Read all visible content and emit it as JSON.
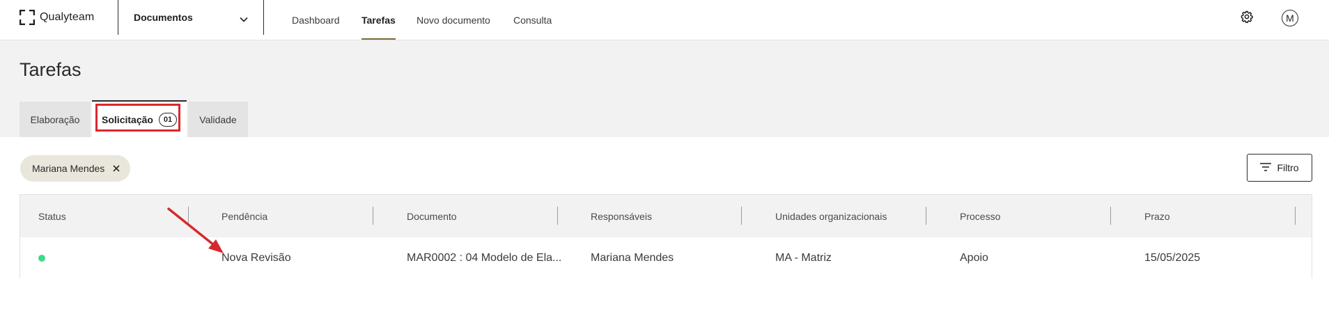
{
  "topbar": {
    "logo_text": "Qualyteam",
    "module_label": "Documentos",
    "nav": [
      {
        "label": "Dashboard",
        "active": false
      },
      {
        "label": "Tarefas",
        "active": true
      },
      {
        "label": "Novo documento",
        "active": false
      },
      {
        "label": "Consulta",
        "active": false
      }
    ],
    "settings_icon": "gear-icon",
    "avatar_initial": "M"
  },
  "page": {
    "title": "Tarefas",
    "tabs": [
      {
        "label": "Elaboração",
        "active": false
      },
      {
        "label": "Solicitação",
        "active": true,
        "badge": "01"
      },
      {
        "label": "Validade",
        "active": false
      }
    ]
  },
  "filters": {
    "chip_label": "Mariana Mendes",
    "filter_button_label": "Filtro"
  },
  "table": {
    "columns": [
      "Status",
      "Pendência",
      "Documento",
      "Responsáveis",
      "Unidades organizacionais",
      "Processo",
      "Prazo"
    ],
    "rows": [
      {
        "status_color": "#3ddc84",
        "pendencia": "Nova Revisão",
        "documento": "MAR0002 : 04 Modelo de Ela...",
        "responsaveis": "Mariana Mendes",
        "unidades": "MA - Matriz",
        "processo": "Apoio",
        "prazo": "15/05/2025"
      }
    ]
  },
  "colors": {
    "accent_underline": "#7a6a3d",
    "annotation_red": "#d9272e",
    "header_bg": "#f2f2f2",
    "chip_bg": "#e9e7dc"
  }
}
